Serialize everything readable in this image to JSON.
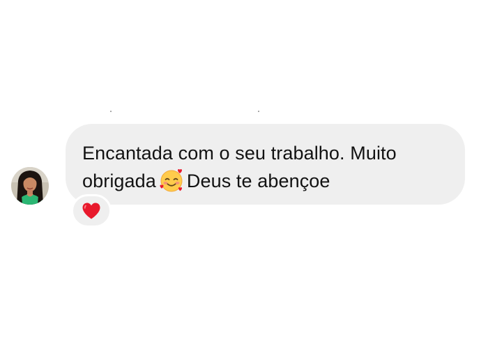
{
  "message": {
    "line1": "Encantada com o seu trabalho. Muito",
    "line2_before_emoji": "obrigada",
    "emoji": "smiling-face-with-hearts-icon",
    "line2_after_emoji": "Deus te abençoe",
    "bubble_color": "#efefef",
    "text_color": "#121212"
  },
  "reaction": {
    "emoji": "red-heart-icon",
    "color": "#e8192c"
  },
  "sender": {
    "avatar": "profile-photo"
  }
}
